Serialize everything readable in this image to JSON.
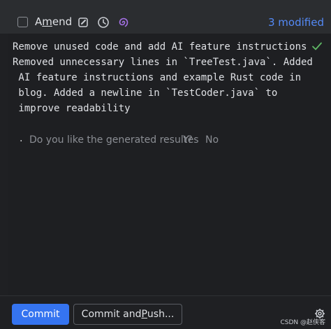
{
  "toolbar": {
    "amend_prefix": "A",
    "amend_mnemonic": "m",
    "amend_suffix": "end",
    "modified_label": "3 modified",
    "icons": [
      "edit-icon",
      "history-icon",
      "ai-spiral-icon"
    ]
  },
  "commit": {
    "lines": [
      "Remove unused code and add AI feature instructions",
      "",
      "Removed unnecessary lines in `TreeTest.java`. Added",
      " AI feature instructions and example Rust code in",
      " blog. Added a newline in `TestCoder.java` to",
      " improve readability"
    ],
    "bullet": ".",
    "question": "Do you like the generated result?",
    "yes": "Yes",
    "no": "No"
  },
  "buttons": {
    "commit_label": "Commit",
    "commit_push_prefix": "Commit and ",
    "commit_push_mnemonic": "P",
    "commit_push_suffix": "ush..."
  },
  "watermark": "CSDN @赵侠客",
  "colors": {
    "accent": "#3574f0",
    "link": "#548af7",
    "success": "#5fb865",
    "ai": "#a571e6"
  }
}
